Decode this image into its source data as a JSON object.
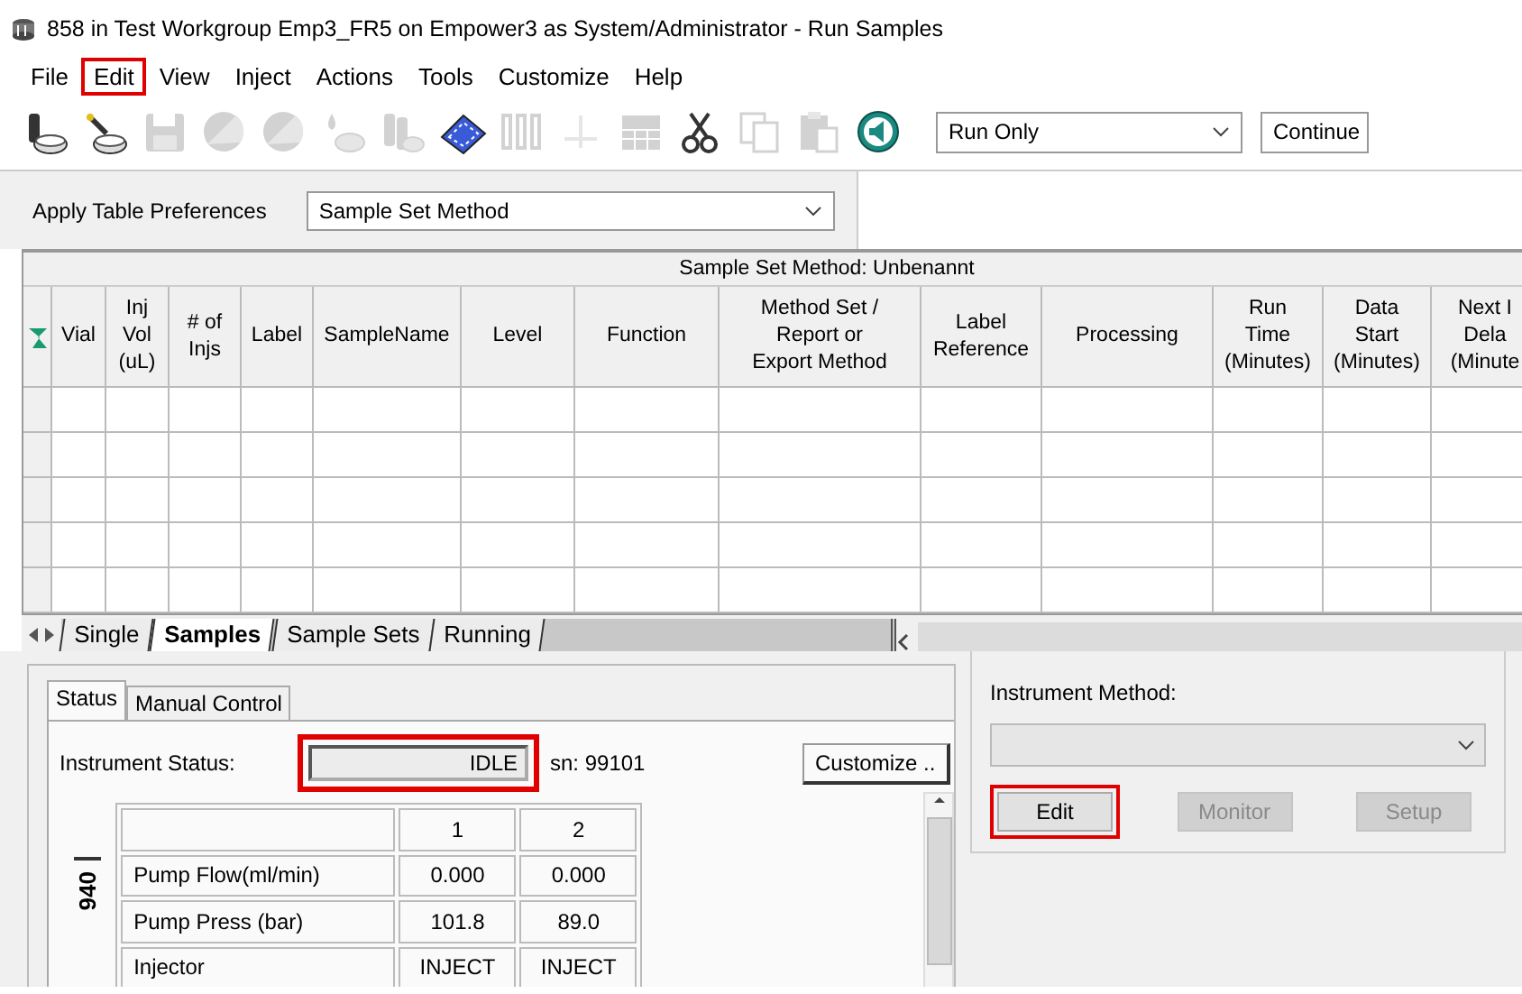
{
  "window": {
    "title": "858 in Test Workgroup Emp3_FR5 on Empower3 as System/Administrator - Run Samples"
  },
  "menu": [
    {
      "label": "File",
      "highlighted": false
    },
    {
      "label": "Edit",
      "highlighted": true
    },
    {
      "label": "View",
      "highlighted": false
    },
    {
      "label": "Inject",
      "highlighted": false
    },
    {
      "label": "Actions",
      "highlighted": false
    },
    {
      "label": "Tools",
      "highlighted": false
    },
    {
      "label": "Customize",
      "highlighted": false
    },
    {
      "label": "Help",
      "highlighted": false
    }
  ],
  "toolbar": {
    "icons": [
      {
        "kind": "vial-tray",
        "disabled": false
      },
      {
        "kind": "wand-tray",
        "disabled": false
      },
      {
        "kind": "save",
        "disabled": true
      },
      {
        "kind": "circle",
        "disabled": true
      },
      {
        "kind": "circle",
        "disabled": true
      },
      {
        "kind": "drops",
        "disabled": true
      },
      {
        "kind": "vials",
        "disabled": true
      },
      {
        "kind": "plate",
        "disabled": false
      },
      {
        "kind": "columns",
        "disabled": true
      },
      {
        "kind": "structure",
        "disabled": true
      },
      {
        "kind": "table",
        "disabled": true
      },
      {
        "kind": "cut",
        "disabled": false
      },
      {
        "kind": "copy",
        "disabled": true
      },
      {
        "kind": "paste",
        "disabled": true
      },
      {
        "kind": "speaker",
        "disabled": false
      }
    ],
    "run_mode": {
      "value": "Run Only"
    },
    "continue_field": {
      "value": "Continue"
    }
  },
  "preferences": {
    "label": "Apply Table Preferences",
    "value": "Sample Set Method"
  },
  "grid": {
    "title": "Sample Set Method: Unbenannt",
    "columns": [
      "Vial",
      "Inj\nVol\n(uL)",
      "# of\nInjs",
      "Label",
      "SampleName",
      "Level",
      "Function",
      "Method Set /\nReport or\nExport Method",
      "Label\nReference",
      "Processing",
      "Run\nTime\n(Minutes)",
      "Data\nStart\n(Minutes)",
      "Next I\nDela\n(Minute"
    ]
  },
  "sheet_tabs": [
    {
      "label": "Single",
      "selected": false
    },
    {
      "label": "Samples",
      "selected": true
    },
    {
      "label": "Sample Sets",
      "selected": false
    },
    {
      "label": "Running",
      "selected": false
    }
  ],
  "status_panel": {
    "tabs": [
      {
        "label": "Status",
        "selected": true
      },
      {
        "label": "Manual Control",
        "selected": false
      }
    ],
    "status_label": "Instrument Status:",
    "status_value": "IDLE",
    "status_highlighted": true,
    "serial": "sn: 99101",
    "customize_button": "Customize ..",
    "module_label": "940",
    "table": {
      "columns": [
        "1",
        "2"
      ],
      "rows": [
        {
          "name": "Pump Flow(ml/min)",
          "values": [
            "0.000",
            "0.000"
          ]
        },
        {
          "name": "Pump Press (bar)",
          "values": [
            "101.8",
            "89.0"
          ]
        },
        {
          "name": "Injector",
          "values": [
            "INJECT",
            "INJECT"
          ]
        }
      ]
    }
  },
  "method_panel": {
    "label": "Instrument Method:",
    "buttons": [
      {
        "label": "Edit",
        "disabled": false,
        "highlighted": true
      },
      {
        "label": "Monitor",
        "disabled": true,
        "highlighted": false
      },
      {
        "label": "Setup",
        "disabled": true,
        "highlighted": false
      }
    ]
  }
}
